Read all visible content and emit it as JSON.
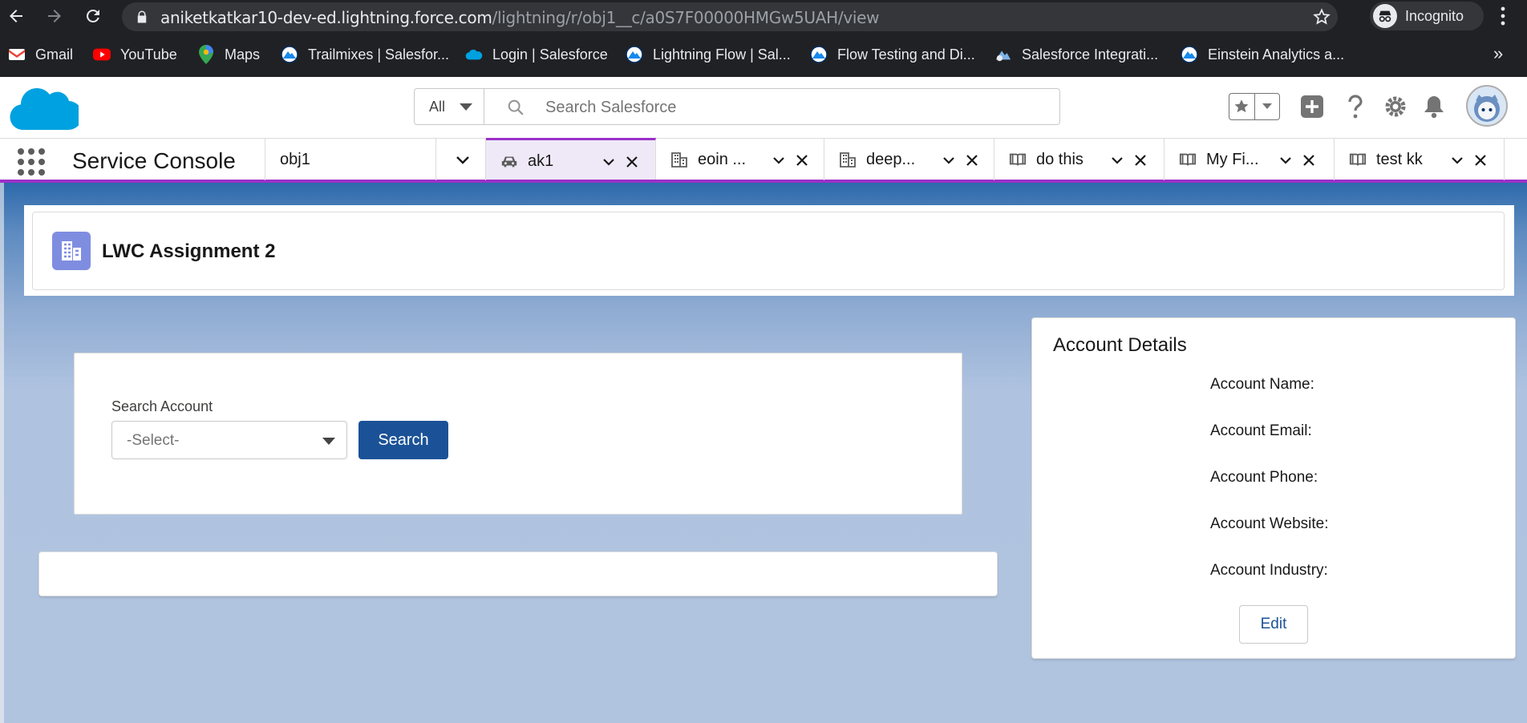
{
  "browser": {
    "url_host": "aniketkatkar10-dev-ed.lightning.force.com",
    "url_path": "/lightning/r/obj1__c/a0S7F00000HMGw5UAH/view",
    "profile_label": "Incognito",
    "bookmarks": [
      {
        "label": "Gmail",
        "icon": "gmail-icon"
      },
      {
        "label": "YouTube",
        "icon": "youtube-icon"
      },
      {
        "label": "Maps",
        "icon": "maps-icon"
      },
      {
        "label": "Trailmixes | Salesfor...",
        "icon": "trailhead-icon"
      },
      {
        "label": "Login | Salesforce",
        "icon": "salesforce-cloud-icon"
      },
      {
        "label": "Lightning Flow | Sal...",
        "icon": "trailhead-icon"
      },
      {
        "label": "Flow Testing and Di...",
        "icon": "trailhead-icon"
      },
      {
        "label": "Salesforce Integrati...",
        "icon": "salesforce-blog-icon"
      },
      {
        "label": "Einstein Analytics a...",
        "icon": "trailhead-icon"
      }
    ],
    "more_label": "»"
  },
  "header": {
    "search_scope": "All",
    "search_placeholder": "Search Salesforce"
  },
  "console_nav": {
    "app_name": "Service Console",
    "nav_item": "obj1",
    "tabs": [
      {
        "label": "ak1",
        "icon": "car-icon",
        "active": true
      },
      {
        "label": "eoin ...",
        "icon": "building-icon",
        "active": false
      },
      {
        "label": "deep...",
        "icon": "building-icon",
        "active": false
      },
      {
        "label": "do this",
        "icon": "book-icon",
        "active": false
      },
      {
        "label": "My Fi...",
        "icon": "book-icon",
        "active": false
      },
      {
        "label": "test kk",
        "icon": "book-icon",
        "active": false
      }
    ]
  },
  "page": {
    "title": "LWC Assignment 2",
    "search_card": {
      "label": "Search Account",
      "select_value": "-Select-",
      "button_label": "Search"
    },
    "account_details": {
      "title": "Account Details",
      "fields": [
        "Account Name:",
        "Account Email:",
        "Account Phone:",
        "Account Website:",
        "Account Industry:"
      ],
      "edit_label": "Edit"
    }
  },
  "colors": {
    "brand_blue": "#1b5297",
    "console_accent": "#9b30c8",
    "salesforce_cloud": "#00a1e0",
    "page_icon": "#7f8de1"
  }
}
